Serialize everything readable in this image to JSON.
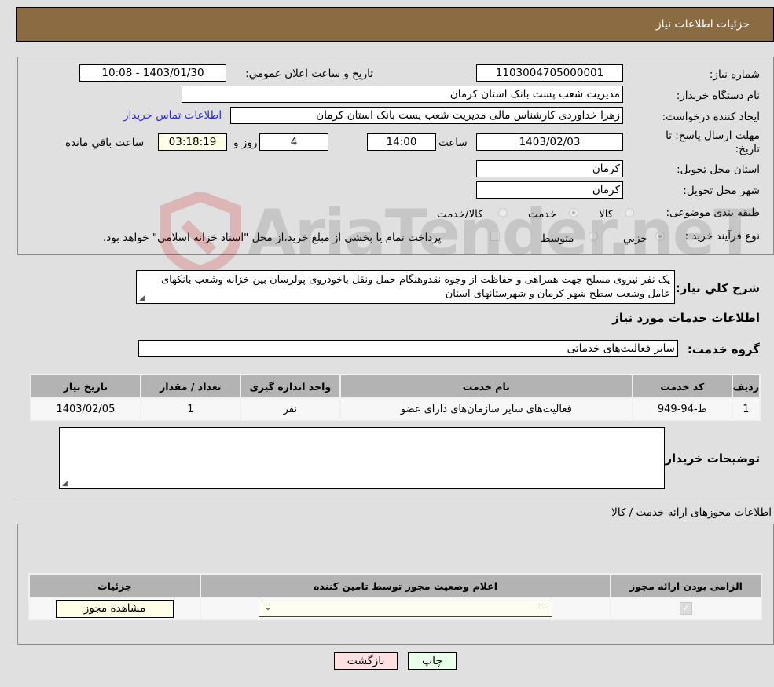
{
  "header": {
    "title": "جزئيات اطلاعات نياز"
  },
  "form": {
    "need_number_label": "شماره نیاز:",
    "need_number": "1103004705000001",
    "announce_label": "تاریخ و ساعت اعلان عمومي:",
    "announce_value": "1403/01/30 - 10:08",
    "buyer_org_label": "نام دستگاه خریدار:",
    "buyer_org": "مدیریت شعب پست بانک استان کرمان",
    "creator_label": "ایجاد کننده درخواست:",
    "creator": "زهرا خداوردی  کارشناس مالی  مدیریت شعب پست بانک استان کرمان",
    "buyer_contact_link": "اطلاعات تماس خریدار",
    "deadline_label_line1": "مهلت ارسال پاسخ: تا",
    "deadline_label_line2": "تاریخ:",
    "deadline_date": "1403/02/03",
    "time_label": "ساعت",
    "deadline_time": "14:00",
    "days_value": "4",
    "days_label": "روز و",
    "remaining_time": "03:18:19",
    "remaining_label": "ساعت باقي مانده",
    "province_label": "استان محل تحویل:",
    "province": "کرمان",
    "city_label": "شهر محل تحویل:",
    "city": "کرمان",
    "category_label": "طبقه بندی موضوعی:",
    "category_options": [
      {
        "label": "کالا",
        "selected": false
      },
      {
        "label": "خدمت",
        "selected": true
      },
      {
        "label": "کالا/خدمت",
        "selected": false
      }
    ],
    "process_label": "نوع فرآیند خرید :",
    "process_options": [
      {
        "label": "جزيي",
        "selected": true
      },
      {
        "label": "متوسط",
        "selected": false
      }
    ],
    "treasury_note": "پرداخت تمام یا بخشی از مبلغ خرید،از محل \"اسناد خزانه اسلامی\" خواهد بود.",
    "treasury_checked": false,
    "description_label": "شرح کلي نياز:",
    "description": "یک نفر نیروی مسلح جهت همراهی و حفاظت از وجوه نقدوهنگام حمل ونقل باخودروی پولرسان بین خزانه وشعب بانکهای عامل وشعب سطح شهر کرمان و شهرستانهای استان"
  },
  "services": {
    "section_title": "اطلاعات خدمات مورد نیاز",
    "group_label": "گروه خدمت:",
    "group_value": "سایر فعالیت‌های خدماتی",
    "table": {
      "headers": [
        "ردیف",
        "کد خدمت",
        "نام خدمت",
        "واحد اندازه گیری",
        "تعداد / مقدار",
        "تاریخ نیاز"
      ],
      "rows": [
        [
          "1",
          "ط-94-949",
          "فعالیت‌های سایر سازمان‌های دارای عضو",
          "نفر",
          "1",
          "1403/02/05"
        ]
      ]
    },
    "buyer_notes_label": "توضیحات خریدار:",
    "buyer_notes": ""
  },
  "permits": {
    "section_title": "اطلاعات مجوزهای ارائه خدمت / کالا",
    "headers": [
      "الزامی بودن ارائه مجوز",
      "اعلام وضعیت مجوز توسط تامین کننده",
      "جزئیات"
    ],
    "row": {
      "required_checked": true,
      "status_select": "--",
      "view_button": "مشاهده مجوز"
    }
  },
  "buttons": {
    "print": "چاپ",
    "back": "بازگشت"
  },
  "watermark": {
    "text": "AriaTender.neT"
  }
}
